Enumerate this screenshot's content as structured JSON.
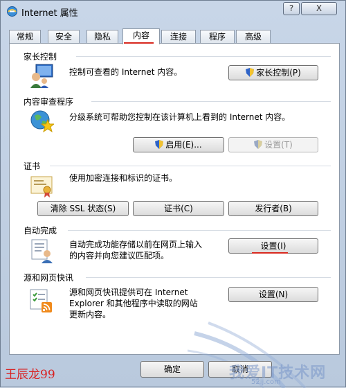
{
  "window": {
    "title": "Internet 属性",
    "help_label": "?",
    "close_label": "X"
  },
  "tabs": [
    {
      "label": "常规"
    },
    {
      "label": "安全"
    },
    {
      "label": "隐私"
    },
    {
      "label": "内容"
    },
    {
      "label": "连接"
    },
    {
      "label": "程序"
    },
    {
      "label": "高级"
    }
  ],
  "active_tab": "内容",
  "groups": {
    "parental": {
      "title": "家长控制",
      "desc": "控制可查看的 Internet 内容。",
      "button": "家长控制(P)"
    },
    "content_advisor": {
      "title": "内容审查程序",
      "desc": "分级系统可帮助您控制在该计算机上看到的 Internet 内容。",
      "enable_button": "启用(E)...",
      "settings_button": "设置(T)"
    },
    "certificates": {
      "title": "证书",
      "desc": "使用加密连接和标识的证书。",
      "clear_ssl_button": "清除 SSL 状态(S)",
      "certs_button": "证书(C)",
      "publishers_button": "发行者(B)"
    },
    "autocomplete": {
      "title": "自动完成",
      "desc_line1": "自动完成功能存储以前在网页上输入",
      "desc_line2": "的内容并向您建议匹配项。",
      "settings_button": "设置(I)"
    },
    "feeds": {
      "title": "源和网页快讯",
      "desc_line1": "源和网页快讯提供可在 Internet",
      "desc_line2": "Explorer 和其他程序中读取的网站",
      "desc_line3": "更新内容。",
      "settings_button": "设置(N)"
    }
  },
  "footer": {
    "ok_label": "确定",
    "cancel_label": "取消"
  },
  "overlay": {
    "signature": "王辰龙99",
    "watermark": "我爱IT技术网",
    "watermark_sub": "52ij.com"
  },
  "colors": {
    "annotation_red": "#d8281e"
  }
}
